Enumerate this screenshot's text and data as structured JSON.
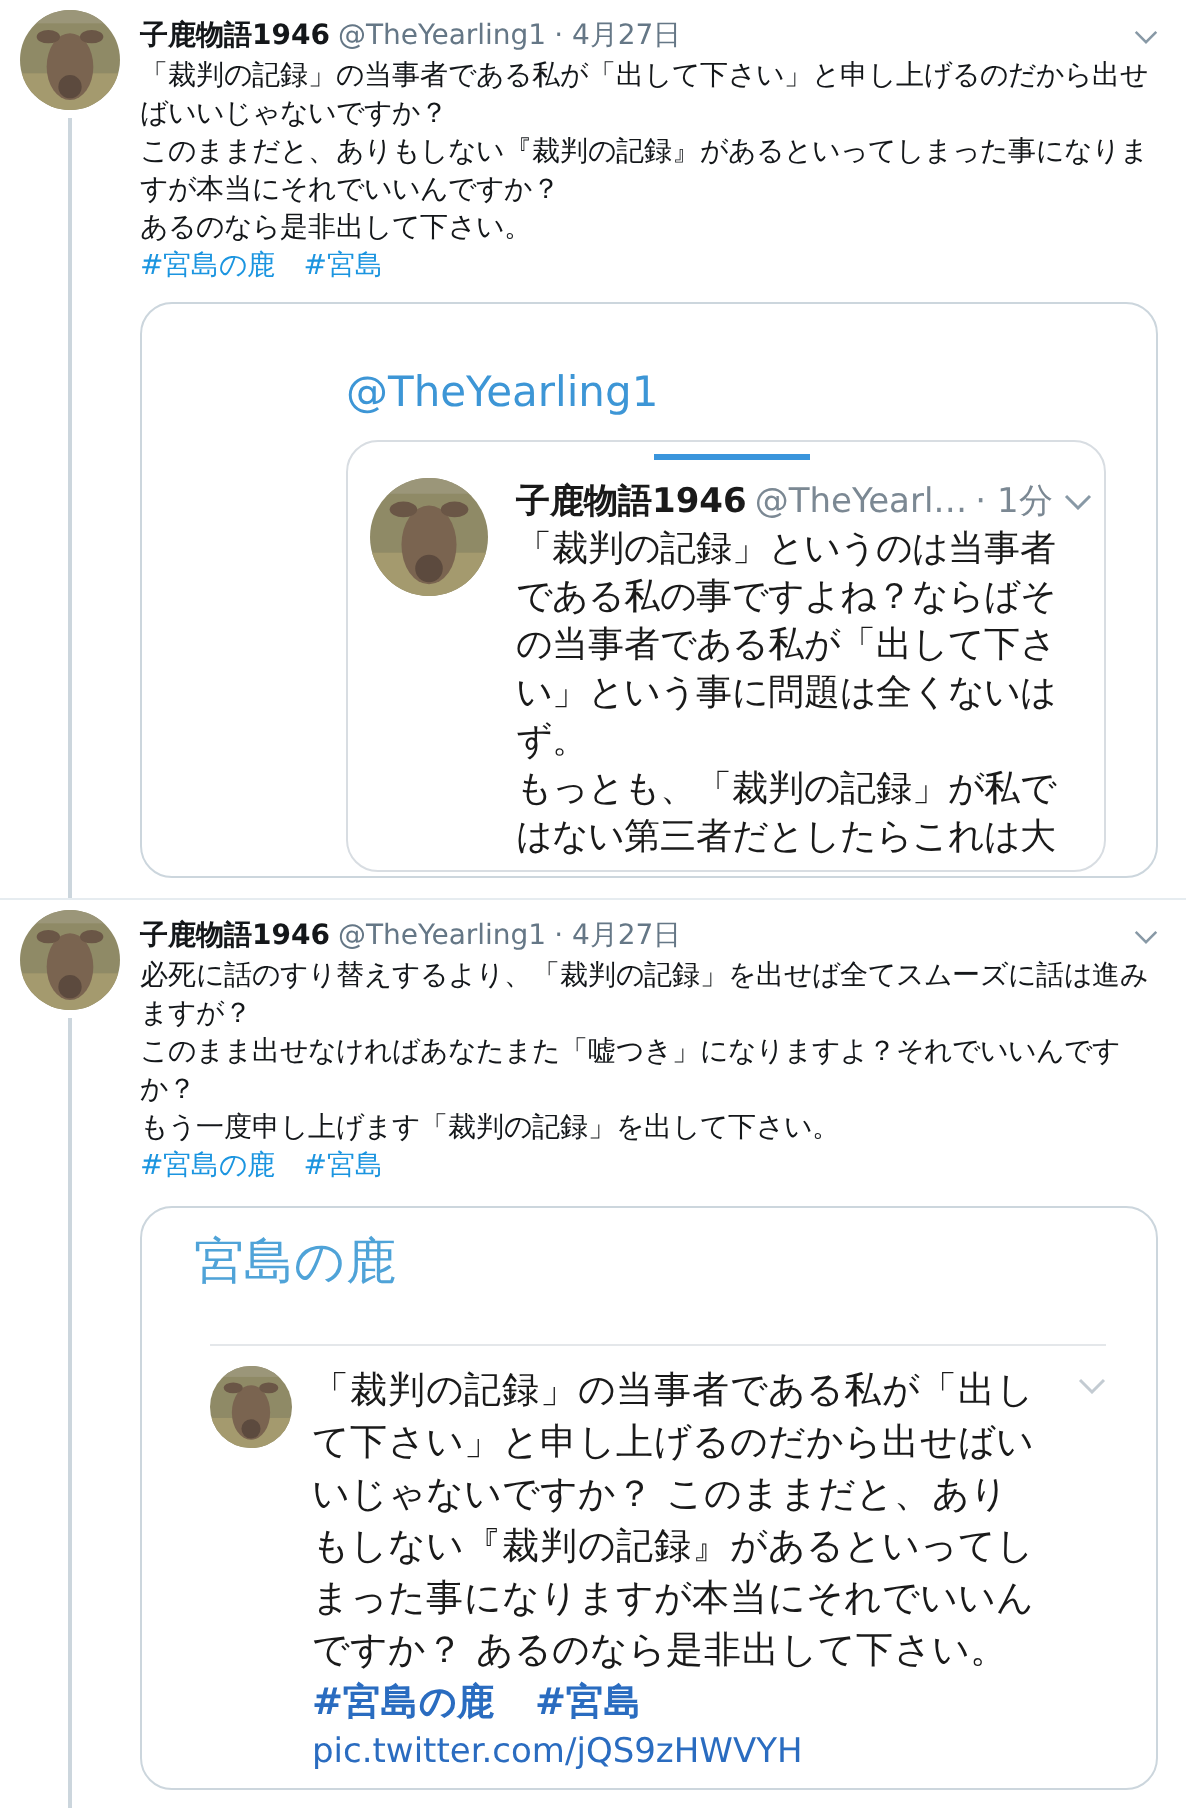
{
  "tweets": [
    {
      "name": "子鹿物語1946",
      "handle": "@TheYearling1",
      "date": "· 4月27日",
      "lines": [
        "「裁判の記録」の当事者である私が「出して下さい」と申し上げるのだから出せばいいじゃないですか？",
        "このままだと、ありもしない『裁判の記録』があるといってしまった事になりますが本当にそれでいいんですか？",
        "あるのなら是非出して下さい。"
      ],
      "hashtags": [
        "#宮島の鹿",
        "#宮島"
      ],
      "card": {
        "kind": "mention",
        "heading": "@TheYearling1",
        "embedded": {
          "name": "子鹿物語1946",
          "handle": "@TheYearl…",
          "time": "· 1分",
          "lines": [
            "「裁判の記録」というのは当事者",
            "である私の事ですよね？ならばそ",
            "の当事者である私が「出して下さ",
            "い」という事に問題は全くないは",
            "ず。",
            "もっとも、「裁判の記録」が私で",
            "はない第三者だとしたらこれは大"
          ]
        }
      }
    },
    {
      "name": "子鹿物語1946",
      "handle": "@TheYearling1",
      "date": "· 4月27日",
      "lines": [
        "必死に話のすり替えするより、「裁判の記録」を出せば全てスムーズに話は進みますが？",
        "このまま出せなければあなたまた「嘘つき」になりますよ？それでいいんですか？",
        "もう一度申し上げます「裁判の記録」を出して下さい。"
      ],
      "hashtags": [
        "#宮島の鹿",
        "#宮島"
      ],
      "card": {
        "kind": "title",
        "heading": "宮島の鹿",
        "embedded": {
          "lines": [
            "「裁判の記録」の当事者である私が「出し",
            "て下さい」と申し上げるのだから出せばい",
            "いじゃないですか？ このままだと、あり",
            "もしない『裁判の記録』があるといってし",
            "まった事になりますが本当にそれでいいん",
            "ですか？ あるのなら是非出して下さい。"
          ],
          "hashtags": [
            "#宮島の鹿",
            "#宮島"
          ],
          "link": "pic.twitter.com/jQS9zHWVYH"
        }
      }
    }
  ]
}
